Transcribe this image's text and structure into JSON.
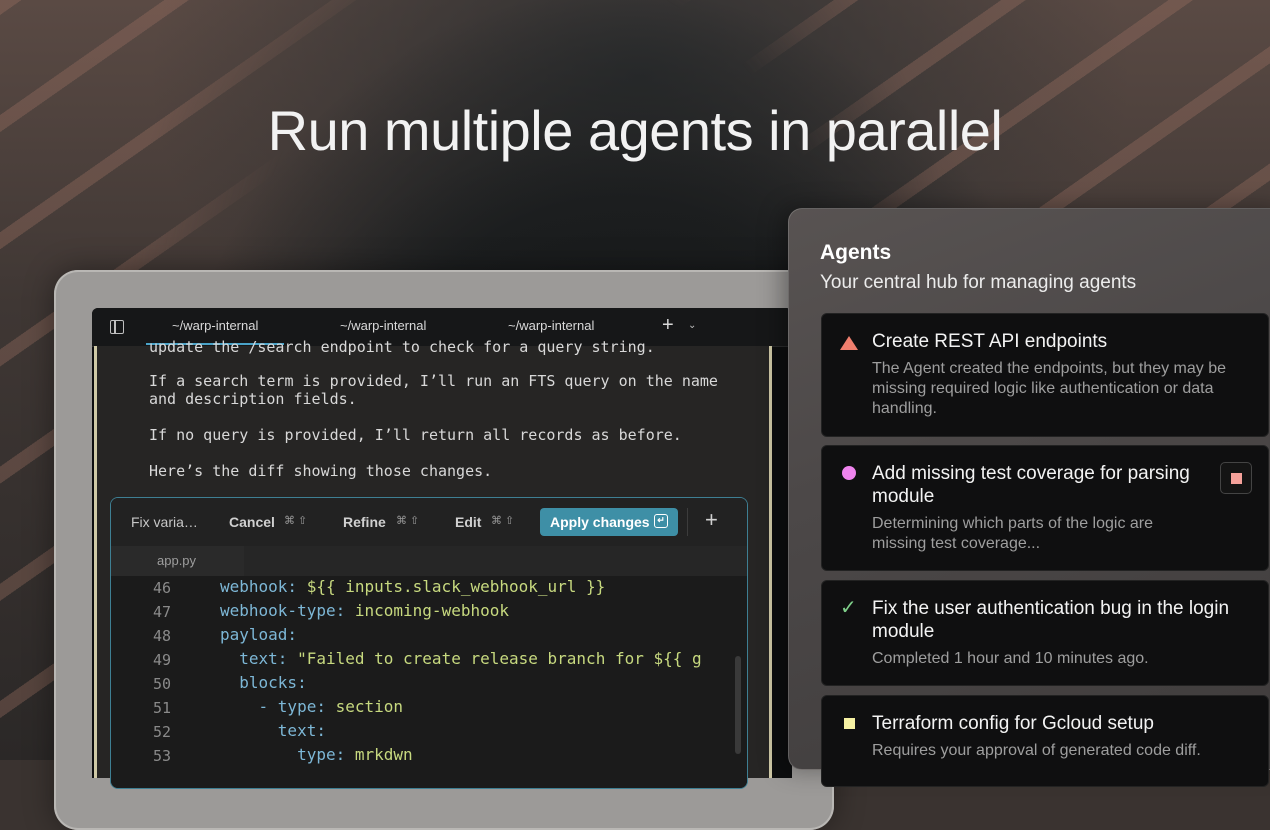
{
  "headline": "Run multiple agents in parallel",
  "terminal": {
    "tabs": [
      "~/warp-internal",
      "~/warp-internal",
      "~/warp-internal"
    ],
    "new_tab": "+",
    "tab_menu": "⌄",
    "lines": [
      "update the /search endpoint to check for a query string.",
      "If a search term is provided, I’ll run an FTS query on the name",
      "and description fields.",
      "If no query is provided, I’ll return all records as before.",
      "Here’s the diff showing those changes."
    ]
  },
  "diff": {
    "title": "Fix varia…",
    "cancel": "Cancel",
    "cancel_kbd": "⌘ ⇧",
    "refine": "Refine",
    "refine_kbd": "⌘ ⇧",
    "edit": "Edit",
    "edit_kbd": "⌘ ⇧",
    "apply": "Apply changes",
    "apply_key": "↵",
    "add": "+",
    "file": "app.py",
    "lines": [
      {
        "n": "46",
        "key": "webhook:",
        "val": " ${{ inputs.slack_webhook_url }}"
      },
      {
        "n": "47",
        "key": "webhook-type:",
        "val": " incoming-webhook"
      },
      {
        "n": "48",
        "key": "payload:",
        "val": ""
      },
      {
        "n": "49",
        "key": "  text:",
        "val": " \"Failed to create release branch for ${{ g"
      },
      {
        "n": "50",
        "key": "  blocks:",
        "val": ""
      },
      {
        "n": "51",
        "key": "    - type:",
        "val": " section"
      },
      {
        "n": "52",
        "key": "      text:",
        "val": ""
      },
      {
        "n": "53",
        "key": "        type:",
        "val": " mrkdwn"
      }
    ]
  },
  "agents": {
    "title": "Agents",
    "subtitle": "Your central hub for managing agents",
    "items": [
      {
        "title": "Create REST API endpoints",
        "desc": "The Agent created the endpoints, but they may be missing required logic like authentication or data handling.",
        "status": "warning",
        "color": "#f07f6e"
      },
      {
        "title": "Add missing test coverage for parsing module",
        "desc": "Determining which parts of the logic are missing test coverage...",
        "status": "running",
        "color": "#ef84ee"
      },
      {
        "title": "Fix the user authentication bug in the login module",
        "desc": "Completed 1 hour and 10 minutes ago.",
        "status": "done",
        "color": "#7fd08a"
      },
      {
        "title": "Terraform config for Gcloud setup",
        "desc": "Requires your approval of generated code diff.",
        "status": "pending",
        "color": "#f6f1a3"
      }
    ]
  },
  "colors": {
    "accent": "#3e8fa6",
    "key": "#7db7d6",
    "value": "#c7d97f"
  }
}
